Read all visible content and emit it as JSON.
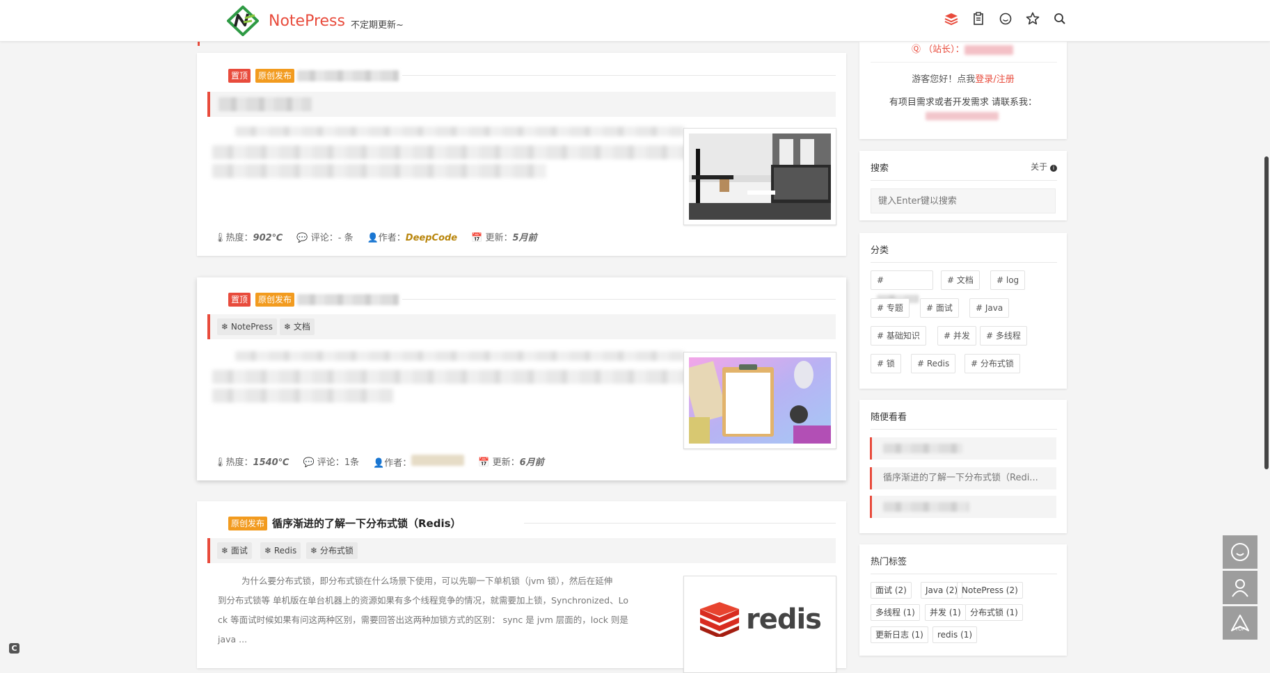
{
  "header": {
    "brand": "NotePress",
    "slogan": "不定期更新~",
    "icons": [
      "layers-icon",
      "clipboard-icon",
      "smile-icon",
      "star-icon",
      "search-icon"
    ]
  },
  "posts": [
    {
      "badges": [
        "置顶",
        "原创发布"
      ],
      "meta": {
        "heat_label": "热度：",
        "heat": "902℃",
        "comment_label": "评论：",
        "comments": "- 条",
        "author_label": "作者：",
        "author": "DeepCode",
        "update_label": "更新：",
        "updated": "5月前"
      }
    },
    {
      "badges": [
        "置顶",
        "原创发布"
      ],
      "tags": [
        "NotePress",
        "文档"
      ],
      "meta": {
        "heat_label": "热度：",
        "heat": "1540℃",
        "comment_label": "评论：",
        "comments": "1条",
        "author_label": "作者：",
        "update_label": "更新：",
        "updated": "6月前"
      }
    },
    {
      "badges": [
        "原创发布"
      ],
      "title": "循序渐进的了解一下分布式锁（Redis）",
      "tags": [
        "面试",
        "Redis",
        "分布式锁"
      ],
      "excerpt": [
        "为什么要分布式锁，即分布式锁在什么场景下使用，可以先聊一下单机锁（jvm 锁），然后在延伸",
        "到分布式锁等 单机版在单台机器上的资源如果有多个线程竞争的情况，就需要加上锁，Synchronized、Lo",
        "ck 等面试时候如果有问这两种区别，需要回答出这两种加锁方式的区别： sync 是 jvm 层面的，lock 则是",
        "java ..."
      ],
      "thumb_text": "redis"
    }
  ],
  "sidebar": {
    "user": {
      "role": "（站长）：",
      "greeting_prefix": "游客您好！点我",
      "login": "登录",
      "sep": "/",
      "register": "注册",
      "contact": "有项目需求或者开发需求 请联系我："
    },
    "search": {
      "title": "搜索",
      "about": "关于",
      "placeholder": "键入Enter键以搜索"
    },
    "categories": {
      "title": "分类",
      "items": [
        "文档",
        "log",
        "专题",
        "面试",
        "Java",
        "基础知识",
        "并发",
        "多线程",
        "锁",
        "Redis",
        "分布式锁"
      ]
    },
    "random": {
      "title": "随便看看",
      "items": [
        "",
        "循序渐进的了解一下分布式锁（Redi...",
        ""
      ]
    },
    "hot_tags": {
      "title": "热门标签",
      "items": [
        "面试 (2)",
        "Java (2)",
        "NotePress (2)",
        "多线程 (1)",
        "并发 (1)",
        "分布式锁 (1)",
        "更新日志 (1)",
        "redis (1)"
      ]
    }
  },
  "float": {
    "top_label": "TOP"
  },
  "colors": {
    "accent": "#e84b3c",
    "orange": "#f29b1f",
    "author": "#b9860d"
  }
}
